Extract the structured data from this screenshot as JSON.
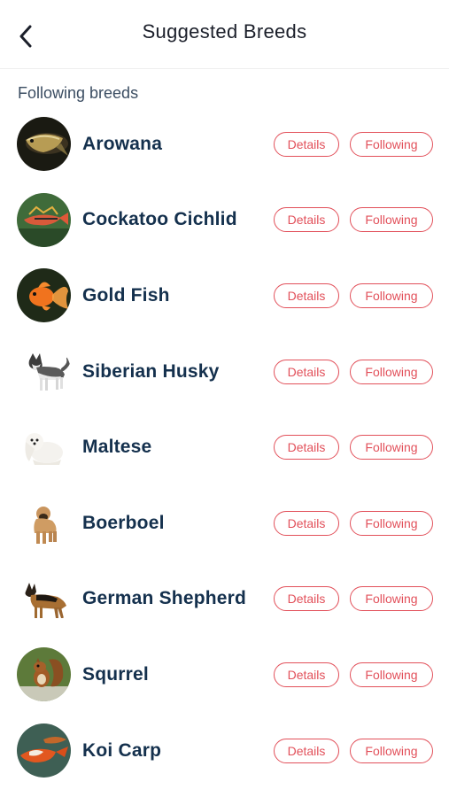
{
  "header": {
    "title": "Suggested Breeds",
    "back_icon": "chevron-left-icon"
  },
  "section_label": "Following breeds",
  "accent_color": "#e2505a",
  "breeds": [
    {
      "name": "Arowana",
      "details_label": "Details",
      "following_label": "Following",
      "image": "arowana-fish-photo"
    },
    {
      "name": "Cockatoo Cichlid",
      "details_label": "Details",
      "following_label": "Following",
      "image": "cichlid-fish-photo"
    },
    {
      "name": "Gold Fish",
      "details_label": "Details",
      "following_label": "Following",
      "image": "goldfish-photo"
    },
    {
      "name": "Siberian Husky",
      "details_label": "Details",
      "following_label": "Following",
      "image": "husky-dog-photo"
    },
    {
      "name": "Maltese",
      "details_label": "Details",
      "following_label": "Following",
      "image": "maltese-dog-photo"
    },
    {
      "name": "Boerboel",
      "details_label": "Details",
      "following_label": "Following",
      "image": "boerboel-dog-photo"
    },
    {
      "name": "German Shepherd",
      "details_label": "Details",
      "following_label": "Following",
      "image": "german-shepherd-photo"
    },
    {
      "name": "Squrrel",
      "details_label": "Details",
      "following_label": "Following",
      "image": "squirrel-photo"
    },
    {
      "name": "Koi Carp",
      "details_label": "Details",
      "following_label": "Following",
      "image": "koi-carp-photo"
    }
  ]
}
